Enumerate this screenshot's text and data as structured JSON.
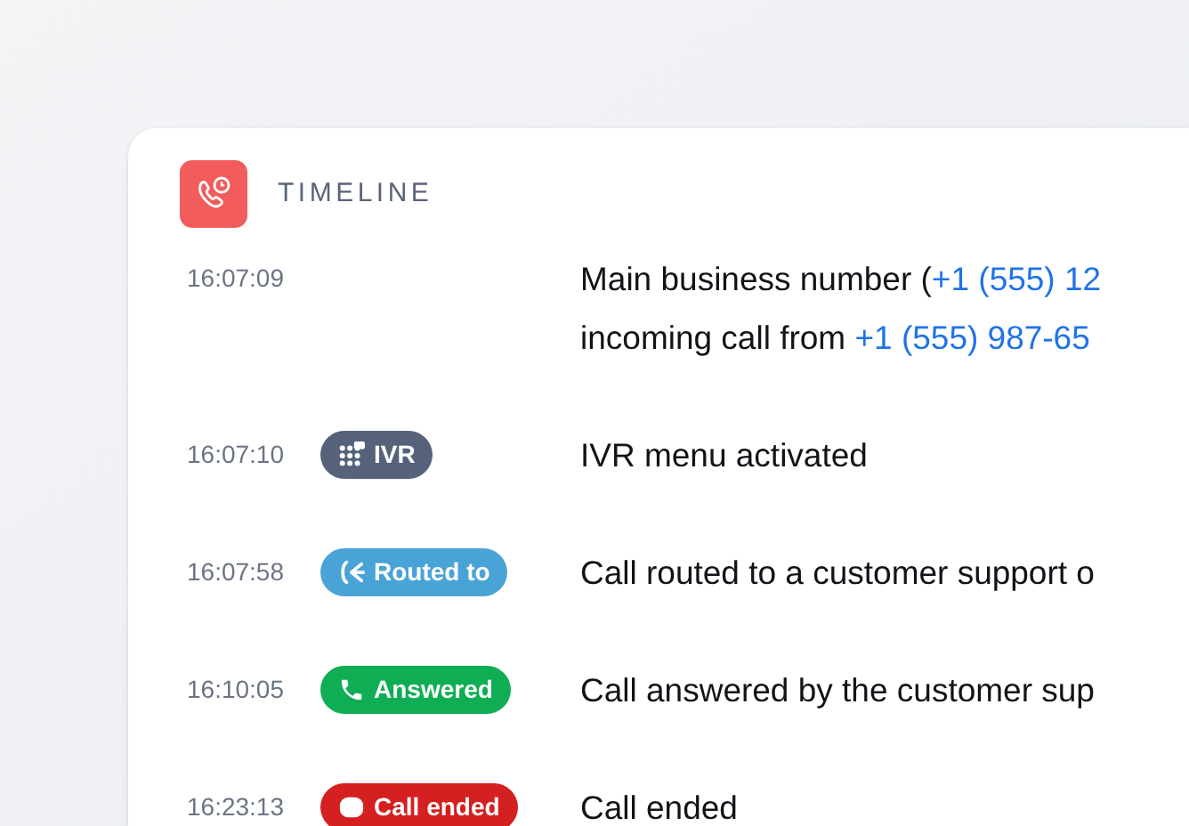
{
  "header": {
    "title": "TIMELINE"
  },
  "events": [
    {
      "time": "16:07:09",
      "lines": [
        [
          {
            "kind": "text",
            "text": "Main business number ("
          },
          {
            "kind": "link",
            "text": "+1 (555) 12"
          }
        ],
        [
          {
            "kind": "text",
            "text": "incoming call from "
          },
          {
            "kind": "link",
            "text": "+1 (555) 987-65"
          }
        ]
      ]
    },
    {
      "time": "16:07:10",
      "badge": {
        "kind": "ivr",
        "label": "IVR",
        "color": "#56627a"
      },
      "lines": [
        [
          {
            "kind": "text",
            "text": "IVR menu activated"
          }
        ]
      ]
    },
    {
      "time": "16:07:58",
      "badge": {
        "kind": "routed",
        "label": "Routed to",
        "color": "#4aa3d6"
      },
      "lines": [
        [
          {
            "kind": "text",
            "text": "Call routed to a customer support o"
          }
        ]
      ]
    },
    {
      "time": "16:10:05",
      "badge": {
        "kind": "answered",
        "label": "Answered",
        "color": "#0fae55"
      },
      "lines": [
        [
          {
            "kind": "text",
            "text": "Call answered by the customer sup"
          }
        ]
      ]
    },
    {
      "time": "16:23:13",
      "badge": {
        "kind": "ended",
        "label": "Call ended",
        "color": "#d42020"
      },
      "lines": [
        [
          {
            "kind": "text",
            "text": "Call ended"
          }
        ]
      ]
    }
  ]
}
